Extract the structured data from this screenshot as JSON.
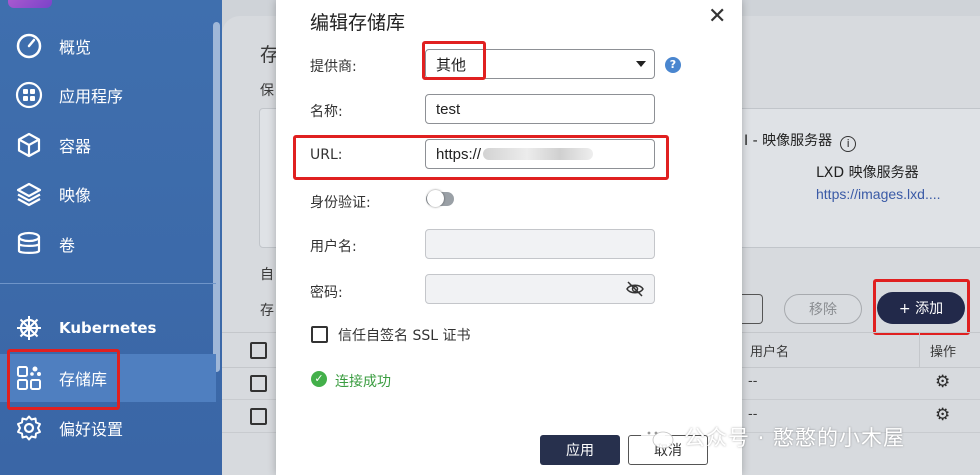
{
  "sidebar": {
    "items": [
      {
        "label": "概览",
        "icon": "gauge-icon"
      },
      {
        "label": "应用程序",
        "icon": "apps-grid-icon"
      },
      {
        "label": "容器",
        "icon": "cube-icon"
      },
      {
        "label": "映像",
        "icon": "layers-icon"
      },
      {
        "label": "卷",
        "icon": "database-icon"
      },
      {
        "label": "Kubernetes",
        "icon": "helm-wheel-icon"
      },
      {
        "label": "存储库",
        "icon": "repository-icon"
      },
      {
        "label": "偏好设置",
        "icon": "gear-icon"
      }
    ],
    "active": "存储库"
  },
  "background_page": {
    "title": "存",
    "label_bao": "保",
    "label_zi": "自",
    "label_cun": "存",
    "card_title": "I - 映像服务器",
    "card_name": "LXD 映像服务器",
    "card_url": "https://images.lxd....",
    "remove_label": "移除",
    "add_label": "+ 添加",
    "col_user": "用户名",
    "col_actions": "操作",
    "row1_user": "--",
    "row2_user": "--"
  },
  "dialog": {
    "title": "编辑存储库",
    "provider_label": "提供商:",
    "provider_value": "其他",
    "name_label": "名称:",
    "name_value": "test",
    "url_label": "URL:",
    "url_value": "https://",
    "auth_label": "身份验证:",
    "username_label": "用户名:",
    "password_label": "密码:",
    "trust_label": "信任自签名 SSL 证书",
    "status_text": "连接成功",
    "apply_label": "应用",
    "cancel_label": "取消"
  },
  "watermark": "公众号 · 憨憨的小木屋",
  "colors": {
    "sidebar": "#3f6fae",
    "primary_button": "#27304d",
    "highlight": "#e02020",
    "success": "#43b04a"
  }
}
